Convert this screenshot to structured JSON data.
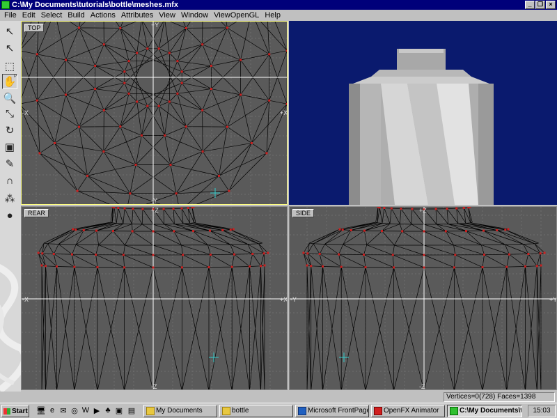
{
  "window": {
    "title": "C:\\My Documents\\tutorials\\bottle\\meshes.mfx"
  },
  "menu": [
    "File",
    "Edit",
    "Select",
    "Build",
    "Actions",
    "Attributes",
    "View",
    "Window",
    "ViewOpenGL",
    "Help"
  ],
  "tools": [
    {
      "name": "select-arrow-icon",
      "glyph": "↖",
      "sub": ""
    },
    {
      "name": "pick-arrow-icon",
      "glyph": "↖",
      "sub": ""
    },
    {
      "name": "box-select-icon",
      "glyph": "⬚",
      "sub": ""
    },
    {
      "name": "hand-pan-icon",
      "glyph": "✋",
      "sub": "P"
    },
    {
      "name": "zoom-icon",
      "glyph": "🔍",
      "sub": ""
    },
    {
      "name": "scale-icon",
      "glyph": "⤡",
      "sub": ""
    },
    {
      "name": "rotate-icon",
      "glyph": "↻",
      "sub": ""
    },
    {
      "name": "frame-icon",
      "glyph": "▣",
      "sub": ""
    },
    {
      "name": "pen-icon",
      "glyph": "✎",
      "sub": ""
    },
    {
      "name": "magnet-icon",
      "glyph": "∩",
      "sub": ""
    },
    {
      "name": "cluster-icon",
      "glyph": "⁂",
      "sub": ""
    },
    {
      "name": "sphere-icon",
      "glyph": "●",
      "sub": ""
    }
  ],
  "viewports": {
    "top": {
      "label": "TOP",
      "axis_top": "+Y",
      "axis_bottom": "-Y",
      "axis_left": "-X",
      "axis_right": "+X"
    },
    "rear": {
      "label": "REAR",
      "axis_top": "+Z",
      "axis_bottom": "-Z",
      "axis_left": "-X",
      "axis_right": "+X"
    },
    "side": {
      "label": "SIDE",
      "axis_top": "+Z",
      "axis_bottom": "-Z",
      "axis_left": "-Y",
      "axis_right": "+Y"
    }
  },
  "status": {
    "info": "Vertices=0(728) Faces=1398"
  },
  "taskbar": {
    "start": "Start",
    "buttons": [
      "My Documents",
      "bottle",
      "Microsoft FrontPage",
      "OpenFX Animator",
      "C:\\My Documents\\t..."
    ],
    "clock": "15:03"
  },
  "colors": {
    "viewport_bg": "#5a5a5a",
    "gl_bg": "#0a1a6e",
    "vertex": "#cc2020",
    "grid": "#6e6e6e"
  }
}
